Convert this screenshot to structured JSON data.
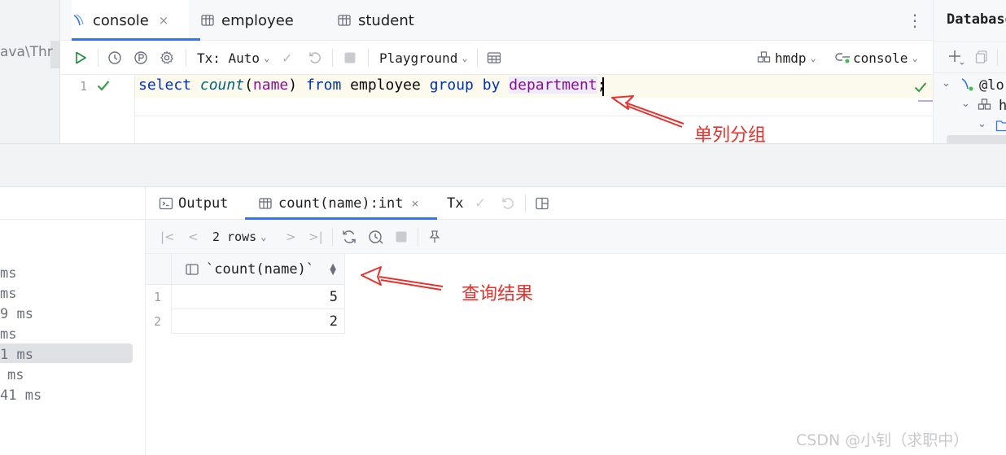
{
  "left_panel": {
    "path_fragment": "ava\\Thr",
    "items": [
      "ms",
      "ms",
      "9 ms",
      "ms",
      "1 ms",
      "ms",
      "41 ms"
    ]
  },
  "tabs": [
    {
      "label": "console",
      "icon": "console-icon",
      "active": true,
      "close": "×"
    },
    {
      "label": "employee",
      "icon": "table-icon",
      "active": false
    },
    {
      "label": "student",
      "icon": "table-icon",
      "active": false
    }
  ],
  "tab_more": "⋮",
  "toolbar": {
    "tx_label": "Tx: Auto",
    "playground_label": "Playground",
    "datasource_label": "hmdp",
    "session_label": "console"
  },
  "editor": {
    "line_number": "1",
    "tokens": {
      "select": "select",
      "count": "count",
      "lparen": "(",
      "name": "name",
      "rparen": ")",
      "from": "from",
      "table": "employee",
      "group": "group",
      "by": "by",
      "department": "department",
      "semicolon": ";"
    }
  },
  "db_panel": {
    "title": "Database",
    "tree": [
      "@lo",
      "h",
      ""
    ]
  },
  "output_tabs": {
    "output_label": "Output",
    "result_label": "count(name):int",
    "tx_label": "Tx"
  },
  "result_toolbar": {
    "rows_label": "2 rows"
  },
  "grid": {
    "column_header": "`count(name)`",
    "rows": [
      {
        "num": "1",
        "value": "5"
      },
      {
        "num": "2",
        "value": "2"
      }
    ]
  },
  "annotations": {
    "group_by_note": "单列分组",
    "result_note": "查询结果"
  },
  "watermark": "CSDN @小钊（求职中）",
  "colors": {
    "accent": "#3574f0",
    "annotation": "#e8312c",
    "keyword": "#0033b3",
    "column": "#871094",
    "function": "#00627a",
    "ok_green": "#4caf50"
  }
}
